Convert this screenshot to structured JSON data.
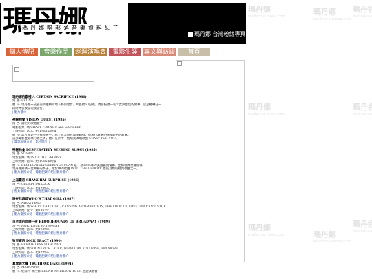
{
  "watermark": {
    "text": "瑪丹娜",
    "sub": "madonna.mooo.com"
  },
  "header": {
    "logo_big": "瑪丹娜",
    "logo_sub": "瑪丹娜唱部落音樂資料網誌",
    "logo_c": "C",
    "right_text": "瑪丹娜 台灣粉絲專頁"
  },
  "nav": [
    {
      "label": "個人傳記",
      "color": "#d9643a"
    },
    {
      "label": "音樂作品",
      "color": "#7aa56b"
    },
    {
      "label": "巡迴演唱會",
      "color": "#b8823c"
    },
    {
      "label": "電影生涯",
      "color": "#c0545a"
    },
    {
      "label": "專文與訪談",
      "color": "#d98a77"
    },
    {
      "label": "首頁",
      "color": "#c9bfa8"
    }
  ],
  "sections": [
    {
      "title": "瑪丹娜的獻禮 A CERTAIN SACRIFICE (1980)",
      "lines": [
        "角 色: BRUNA",
        "簡 介: 瑪丹娜未成名前所拍攝的地下藝術電影，片長約60分鐘，內容描述一名少女與復仇的故事，於是輾轉在一",
        "段時光後被發現後發行。"
      ],
      "links": "| 影片簡介 |"
    },
    {
      "title": "神秘約會 VISION QUEST (1985)",
      "lines": [
        "角 色: 酒吧的歌唱歌手",
        "電影配樂: 瑪 CRAZY FOR YOU and GAMBLER",
        "上映時間: 當 年: 約 1985年時候",
        "簡 介: 影片描述一位摔角選手，為了進入州冠軍爭霸戰，他決心減重並挑戰對手的故事。",
        "這部電影並非瑪丹娜主演，她只在片中一個場景演唱歌曲 CRAZY FOR YOU。"
      ],
      "links": "| 電影配樂介紹 | 影片簡介 |"
    },
    {
      "title": "神秘約會 DESPERATELY SEEKING SUSAN (1985)",
      "lines": [
        "角 色: SUSAN",
        "電影配樂: 瑪 INTO THE GROOVE",
        "上映時間: 當 年: 約 1985年時候",
        "簡 介: DESPERATELY SEEKING SUSAN 是一部1985年的美國喜劇電影，由蘇珊賽德曼執導。",
        "瑪丹娜飾演一位神秘的女子，電影中的歌曲 INTO THE GROOVE 也成為她的經典歌曲之一。"
      ],
      "links": "| 影片劇照介紹 | 電影配樂介紹 | 影片簡介 |"
    },
    {
      "title": "上海驚奇 SHANGHAI SURPRISE (1986)",
      "lines": [
        "角 色: GLORIA TATLOCK",
        "上映時間: 當 年: 約1986年"
      ],
      "links": "| 影片劇照介紹 | 電影配樂介紹 | 影片簡介 |"
    },
    {
      "title": "誰在找麻煩WHO'S THAT GIRL (1987)",
      "lines": [
        "角 色: NIKKI FINN",
        "電影配樂: 瑪 WHO'S THAT GIRL, CAUSING A COMMOTION, THE LOOK OF LOVE, and CAN'T STOP",
        "上映時間: 當 年: 約1987年"
      ],
      "links": "| 影片劇照介紹 | 電影配樂介紹 | 影片簡介 |"
    },
    {
      "title": "百老匯的血腥一夜 BLOODHOUNDS OF BROADWAY (1989)",
      "lines": [
        "角 色: HORTENSE HATHAWAY",
        "上映時間: 當 年: 約1989年"
      ],
      "links": "| 影片劇照介紹 | 電影配樂介紹 | 影片簡介 |"
    },
    {
      "title": "狄克崔西 DICK TRACY (1990)",
      "lines": [
        "角 色: BREATHLESS MAHONEY",
        "電影配樂: 瑪 SOONER OR LATER, WHAT CAN YOU LOSE, and MORE",
        "上映時間: 當 年: 約1990年"
      ],
      "links": "| 影片劇照介紹 | 電影配樂介紹 | 影片簡介 |"
    },
    {
      "title": "真實與大膽 TRUTH OR DARE (1991)",
      "lines": [
        "角 色: MADONNA",
        "簡 介: 紀錄片 瑪丹娜 BLOND AMBITION TOUR 巡迴演唱會"
      ],
      "links": ""
    }
  ]
}
